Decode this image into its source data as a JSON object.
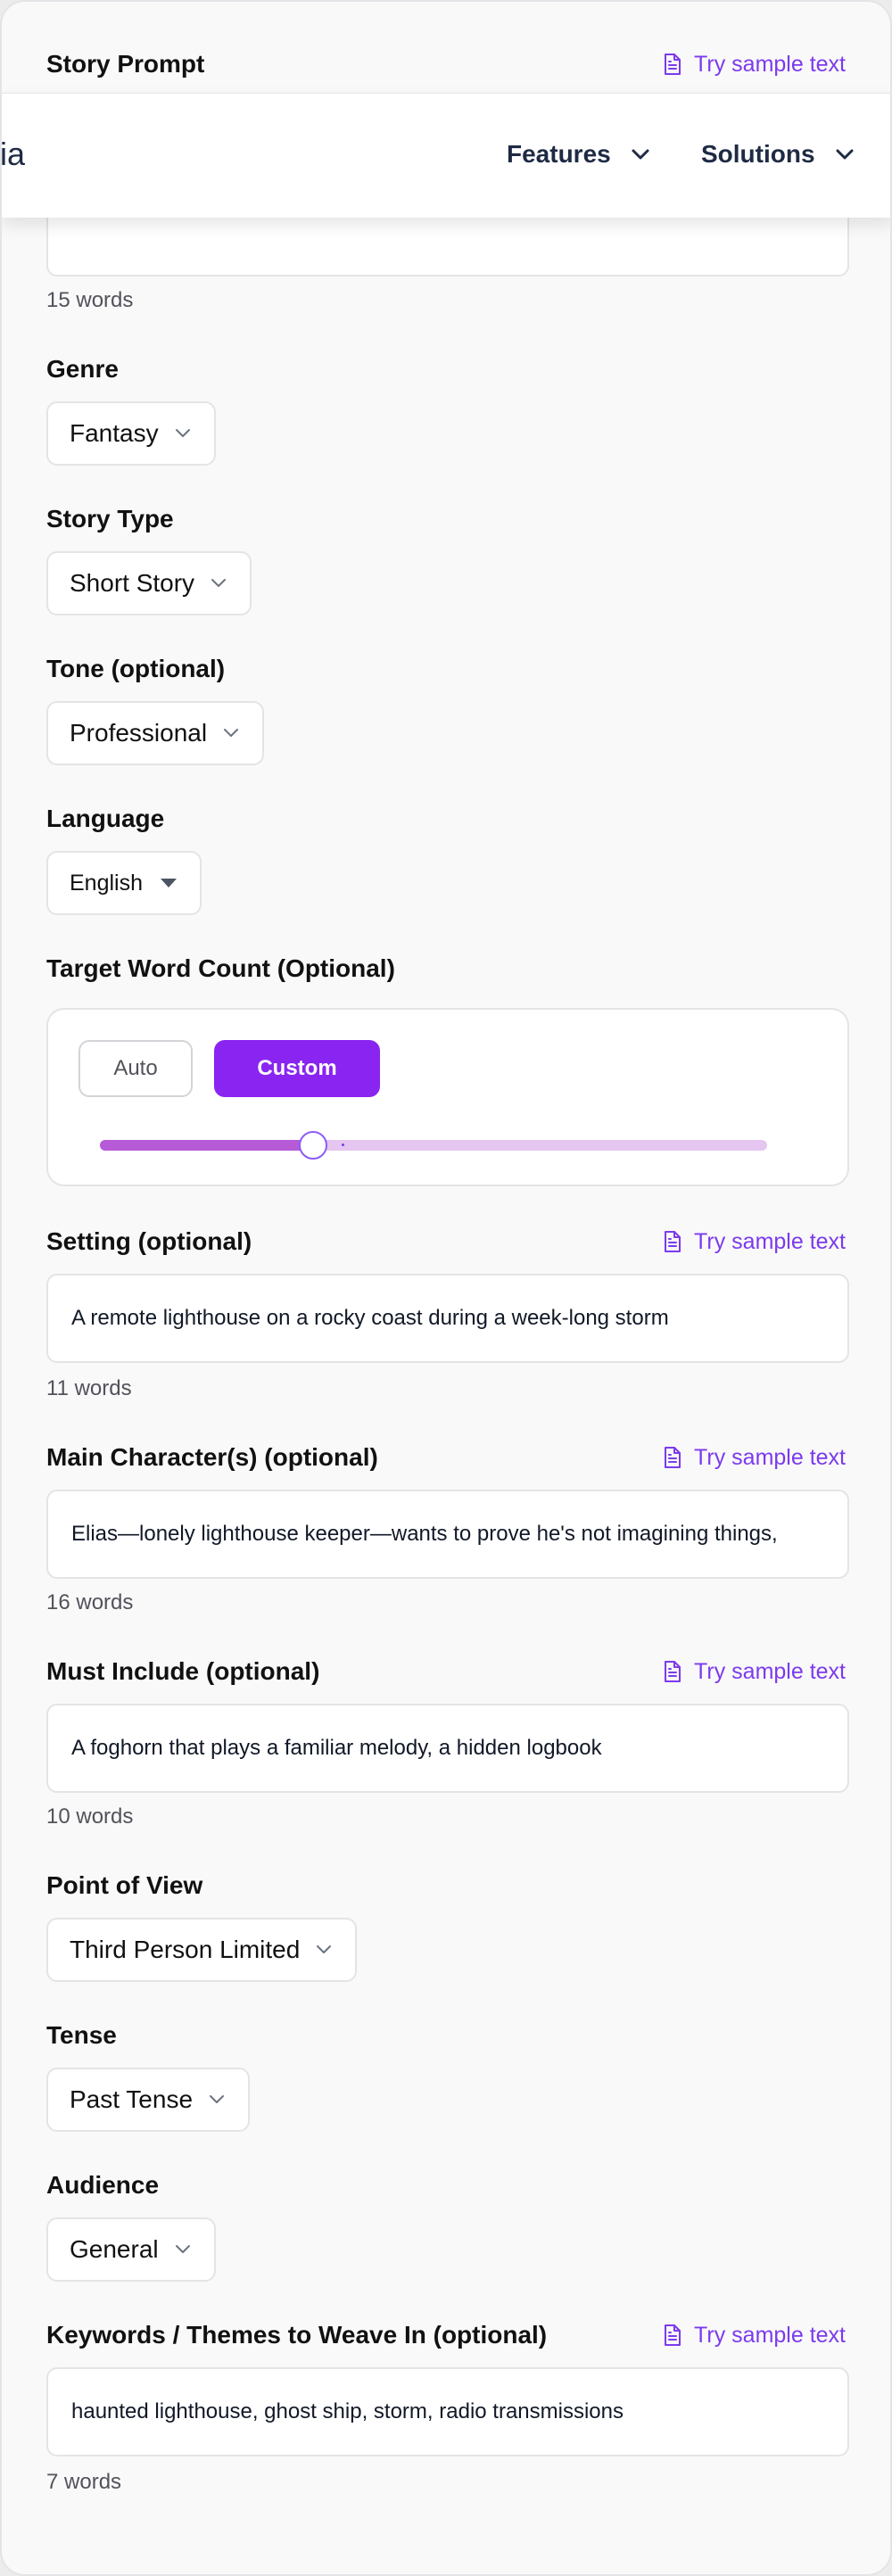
{
  "header": {
    "section_label": "Story Prompt",
    "sample_link": "Try sample text"
  },
  "nav": {
    "logo_fragment": "ia",
    "features_label": "Features",
    "solutions_label": "Solutions"
  },
  "story_prompt": {
    "word_count": "15 words"
  },
  "genre": {
    "label": "Genre",
    "value": "Fantasy"
  },
  "story_type": {
    "label": "Story Type",
    "value": "Short Story"
  },
  "tone": {
    "label": "Tone (optional)",
    "value": "Professional"
  },
  "language": {
    "label": "Language",
    "value": "English"
  },
  "target_word_count": {
    "label": "Target Word Count (Optional)",
    "auto_label": "Auto",
    "custom_label": "Custom",
    "selected": "Custom",
    "slider_fraction": 0.32
  },
  "setting": {
    "label": "Setting (optional)",
    "sample_link": "Try sample text",
    "value": "A remote lighthouse on a rocky coast during a week-long storm",
    "word_count": "11 words"
  },
  "main_characters": {
    "label": "Main Character(s) (optional)",
    "sample_link": "Try sample text",
    "value": "Elias—lonely lighthouse keeper—wants to prove he's not imagining things,",
    "word_count": "16 words"
  },
  "must_include": {
    "label": "Must Include (optional)",
    "sample_link": "Try sample text",
    "value": "A foghorn that plays a familiar melody, a hidden logbook",
    "word_count": "10 words"
  },
  "point_of_view": {
    "label": "Point of View",
    "value": "Third Person Limited"
  },
  "tense": {
    "label": "Tense",
    "value": "Past Tense"
  },
  "audience": {
    "label": "Audience",
    "value": "General"
  },
  "keywords": {
    "label": "Keywords / Themes to Weave In (optional)",
    "sample_link": "Try sample text",
    "value": "haunted lighthouse, ghost ship, storm, radio transmissions",
    "word_count": "7 words"
  },
  "colors": {
    "accent": "#7c3aed",
    "button_primary": "#8a24f0",
    "slider_fill": "#b65ad8",
    "slider_track": "#e5c6f0"
  },
  "icons": {
    "sample": "document-icon",
    "dropdown": "chevron-down-icon",
    "language_dropdown": "caret-down-icon"
  }
}
